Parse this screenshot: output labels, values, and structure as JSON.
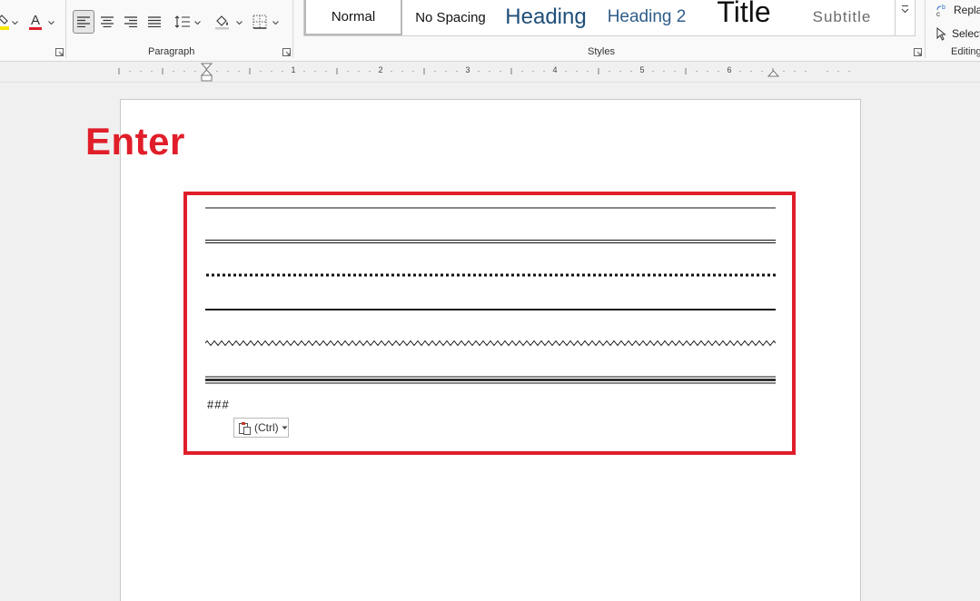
{
  "ribbon": {
    "groups": {
      "paragraph": "Paragraph",
      "styles": "Styles",
      "editing": "Editing"
    },
    "styles": [
      {
        "id": "normal",
        "label": "Normal"
      },
      {
        "id": "no-spacing",
        "label": "No Spacing"
      },
      {
        "id": "heading",
        "label": "Heading"
      },
      {
        "id": "heading2",
        "label": "Heading 2"
      },
      {
        "id": "title",
        "label": "Title"
      },
      {
        "id": "subtitle",
        "label": "Subtitle"
      }
    ],
    "editing": {
      "replace": "Repla",
      "select": "Select"
    },
    "font_color_accent": "#e01e2a",
    "highlight_accent": "#f7e600"
  },
  "ruler": {
    "numbers": [
      "1",
      "2",
      "3",
      "4",
      "5",
      "6"
    ]
  },
  "annotation": {
    "label": "Enter",
    "color": "#e01e2a"
  },
  "document": {
    "line_styles": [
      "single",
      "double",
      "dotted",
      "thick",
      "wavy",
      "triple"
    ],
    "typed_text": "###",
    "paste_options_label": "(Ctrl)"
  }
}
